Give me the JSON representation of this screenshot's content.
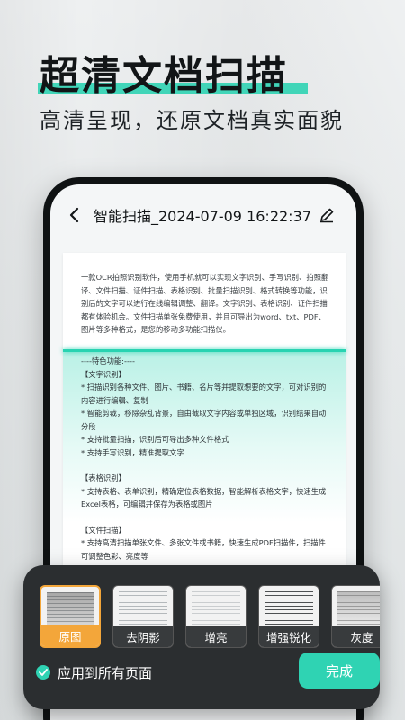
{
  "headline": {
    "title": "超清文档扫描",
    "subtitle": "高清呈现，还原文档真实面貌"
  },
  "screen": {
    "title": "智能扫描_2024-07-09 16:22:37",
    "document": {
      "intro": "一款OCR拍照识别软件，使用手机就可以实现文字识别、手写识别、拍照翻译、文件扫描、证件扫描、表格识别、批量扫描识别、格式转换等功能，识别后的文字可以进行在线编辑调整、翻译。文字识别、表格识别、证件扫描都有体验机会。文件扫描单张免费使用，并且可导出为word、txt、PDF、图片等多种格式，是您的移动多功能扫描仪。",
      "features_heading": "----特色功能:----",
      "sections": [
        {
          "heading": "【文字识别】",
          "items": [
            "* 扫描识别各种文件、图片、书籍、名片等并提取想要的文字，可对识别的内容进行编辑、复制",
            "* 智能剪裁，移除杂乱背景，自由截取文字内容或单独区域，识别结果自动分段",
            "* 支持批量扫描，识别后可导出多种文件格式",
            "* 支持手写识别，精准提取文字"
          ]
        },
        {
          "heading": "【表格识别】",
          "items": [
            "* 支持表格、表单识别，精确定位表格数据，智能解析表格文字，快速生成Excel表格，可编辑并保存为表格或图片"
          ]
        },
        {
          "heading": "【文件扫描】",
          "items": [
            "* 支持高清扫描单张文件、多张文件或书籍，快速生成PDF扫描件，扫描件可调整色彩、亮度等"
          ]
        }
      ]
    }
  },
  "panel": {
    "filters": [
      {
        "label": "原图",
        "selected": true
      },
      {
        "label": "去阴影",
        "selected": false
      },
      {
        "label": "增亮",
        "selected": false
      },
      {
        "label": "增强锐化",
        "selected": false
      },
      {
        "label": "灰度",
        "selected": false
      }
    ],
    "apply_all_label": "应用到所有页面",
    "done_label": "完成"
  },
  "colors": {
    "accent": "#2fd3b3",
    "selected_filter": "#f3a63a",
    "panel_bg": "#2b2e30"
  }
}
